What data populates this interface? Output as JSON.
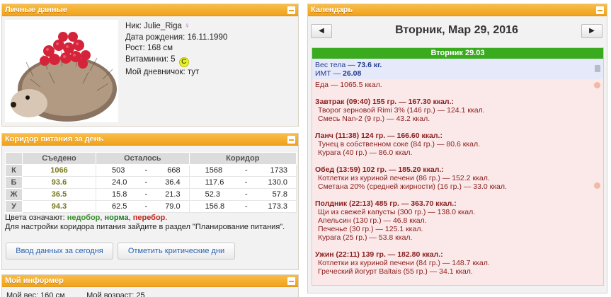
{
  "personal": {
    "header": "Личные данные",
    "nick_label": "Ник:",
    "nick": "Julie_Riga",
    "dob_label": "Дата рождения:",
    "dob": "16.11.1990",
    "height_label": "Рост:",
    "height": "168 см",
    "vit_label": "Витаминки:",
    "vit": "5",
    "vit_badge": "C",
    "diary_label": "Мой дневничок:",
    "diary": "тут"
  },
  "corridor": {
    "header": "Коридор питания за день",
    "columns": [
      "Съедено",
      "Осталось",
      "Коридор"
    ],
    "rows": [
      {
        "label": "К",
        "eaten": "1066",
        "left_a": "503",
        "left_b": "668",
        "corr_a": "1568",
        "corr_b": "1733"
      },
      {
        "label": "Б",
        "eaten": "93.6",
        "left_a": "24.0",
        "left_b": "36.4",
        "corr_a": "117.6",
        "corr_b": "130.0"
      },
      {
        "label": "Ж",
        "eaten": "36.5",
        "left_a": "15.8",
        "left_b": "21.3",
        "corr_a": "52.3",
        "corr_b": "57.8"
      },
      {
        "label": "У",
        "eaten": "94.3",
        "left_a": "62.5",
        "left_b": "79.0",
        "corr_a": "156.8",
        "corr_b": "173.3"
      }
    ],
    "dash": "-",
    "legend_prefix": "Цвета означают:",
    "under": "недобор",
    "norm": "норма",
    "over": "перебор",
    "note": "Для настройки коридора питания зайдите в раздел \"Планирование питания\".",
    "btn_input": "Ввод данных за сегодня",
    "btn_critical": "Отметить критические дни"
  },
  "informer": {
    "header": "Мой информер",
    "line": "Мой вес: 160 см          Мой возраст: 25"
  },
  "calendar": {
    "header": "Календарь",
    "prev": "◀",
    "next": "▶",
    "title": "Вторник, Мар 29, 2016",
    "day_head": "Вторник 29.03",
    "weight_label": "Вес тела — ",
    "weight": "73.6 кг.",
    "bmi_label": "ИМТ — ",
    "bmi": "26.08",
    "food_total": "Еда — 1065.5 ккал.",
    "meals": [
      {
        "title": "Завтрак (09:40) 155 гр. — 167.30 ккал.:",
        "items": [
          "Творог зерновой Rimi 3% (146 гр.) — 124.1 ккал.",
          "Смесь Nan-2 (9 гр.) — 43.2 ккал."
        ]
      },
      {
        "title": "Ланч (11:38) 124 гр. — 166.60 ккал.:",
        "items": [
          "Тунец в собственном соке (84 гр.) — 80.6 ккал.",
          "Курага (40 гр.) — 86.0 ккал."
        ]
      },
      {
        "title": "Обед (13:59) 102 гр. — 185.20 ккал.:",
        "items": [
          "Котлетки из куриной печени (86 гр.) — 152.2 ккал.",
          "Сметана 20% (средней жирности) (16 гр.) — 33.0 ккал."
        ]
      },
      {
        "title": "Полдник (22:13) 485 гр. — 363.70 ккал.:",
        "items": [
          "Щи из свежей капусты (300 гр.) — 138.0 ккал.",
          "Апельсин (130 гр.) — 46.8 ккал.",
          "Печенье (30 гр.) — 125.1 ккал.",
          "Курага (25 гр.) — 53.8 ккал."
        ]
      },
      {
        "title": "Ужин (22:11) 139 гр. — 182.80 ккал.:",
        "items": [
          "Котлетки из куриной печени (84 гр.) — 148.7 ккал.",
          "Греческий йогурт Baltais (55 гр.) — 34.1 ккал."
        ]
      }
    ]
  }
}
